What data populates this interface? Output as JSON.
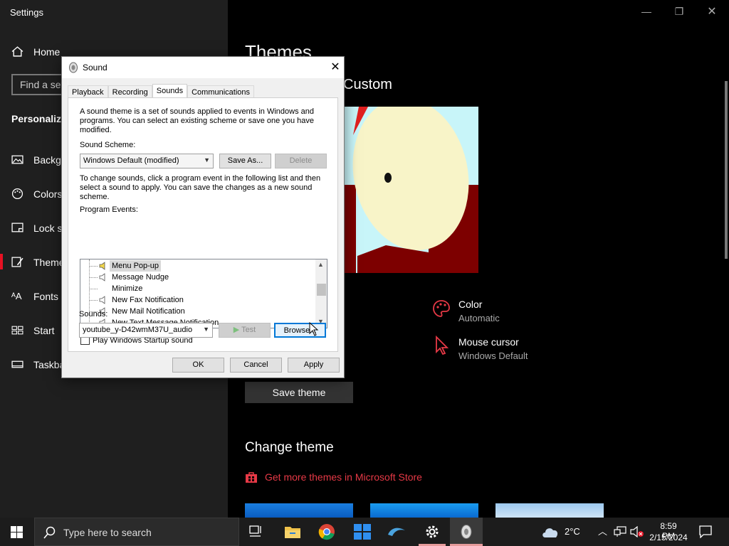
{
  "settings": {
    "window_title": "Settings",
    "home_label": "Home",
    "find_placeholder": "Find a set",
    "section_header": "Personaliza",
    "nav": [
      {
        "label": "Backgr",
        "icon": "image-icon"
      },
      {
        "label": "Colors",
        "icon": "palette-icon"
      },
      {
        "label": "Lock sc",
        "icon": "lock-screen-icon"
      },
      {
        "label": "Theme",
        "icon": "brush-icon"
      },
      {
        "label": "Fonts",
        "icon": "fonts-icon"
      },
      {
        "label": "Start",
        "icon": "start-grid-icon"
      },
      {
        "label": "Taskba",
        "icon": "taskbar-icon"
      }
    ],
    "page_title": "Themes",
    "current_theme": "Custom",
    "color_label": "Color",
    "color_value": "Automatic",
    "cursor_label": "Mouse cursor",
    "cursor_value": "Windows Default",
    "save_theme": "Save theme",
    "change_theme": "Change theme",
    "store_link": "Get more themes in Microsoft Store",
    "accent": "#e63946"
  },
  "dialog": {
    "title": "Sound",
    "tabs": [
      "Playback",
      "Recording",
      "Sounds",
      "Communications"
    ],
    "active_tab": "Sounds",
    "intro": "A sound theme is a set of sounds applied to events in Windows and programs.  You can select an existing scheme or save one you have modified.",
    "scheme_label": "Sound Scheme:",
    "scheme_value": "Windows Default (modified)",
    "save_as": "Save As...",
    "delete": "Delete",
    "instructions": "To change sounds, click a program event in the following list and then select a sound to apply.  You can save the changes as a new sound scheme.",
    "events_label": "Program Events:",
    "events": [
      {
        "label": "Menu Pop-up",
        "speaker": true,
        "selected": true
      },
      {
        "label": "Message Nudge",
        "speaker": true,
        "selected": false
      },
      {
        "label": "Minimize",
        "speaker": false,
        "selected": false
      },
      {
        "label": "New Fax Notification",
        "speaker": true,
        "selected": false
      },
      {
        "label": "New Mail Notification",
        "speaker": true,
        "selected": false
      },
      {
        "label": "New Text Message Notification",
        "speaker": true,
        "selected": false
      }
    ],
    "startup_label": "Play Windows Startup sound",
    "startup_checked": false,
    "sounds_label": "Sounds:",
    "sound_value": "youtube_y-D42wmM37U_audio",
    "test": "Test",
    "browse": "Browse...",
    "ok": "OK",
    "cancel": "Cancel",
    "apply": "Apply"
  },
  "taskbar": {
    "search_placeholder": "Type here to search",
    "weather": "2°C",
    "time": "8:59 PM",
    "date": "2/15/2024",
    "apps": [
      "task-view-icon",
      "file-explorer-icon",
      "chrome-icon",
      "start-app-icon",
      "dolphin-icon",
      "settings-gear-icon",
      "sound-app-icon"
    ]
  }
}
